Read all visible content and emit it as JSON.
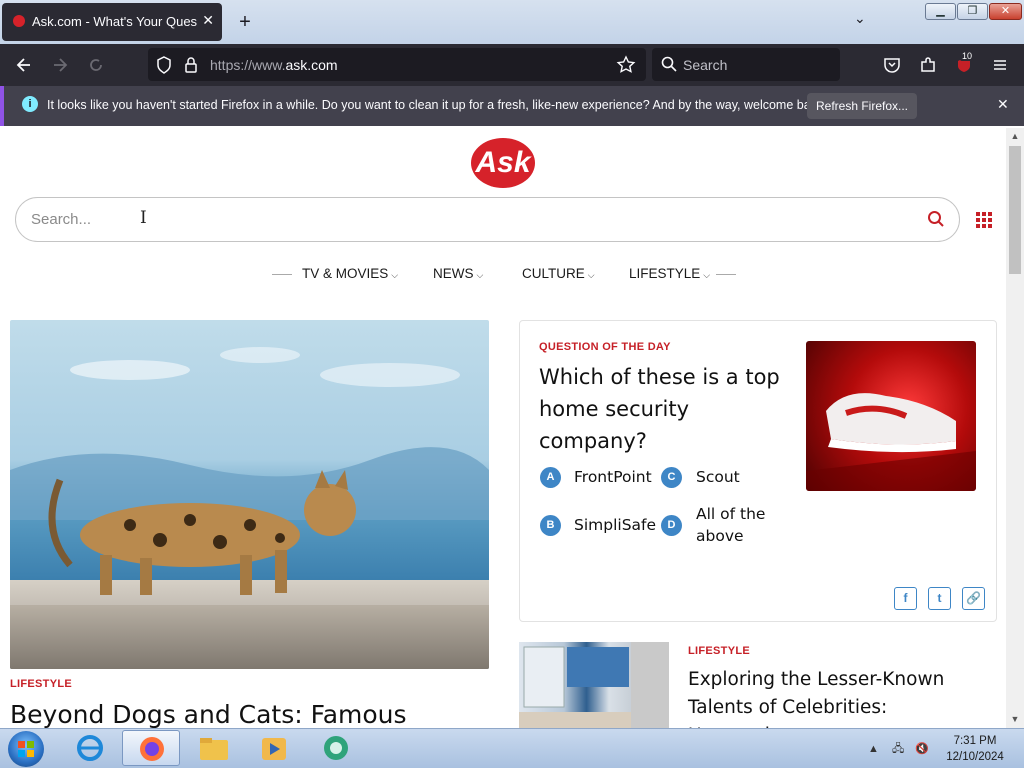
{
  "browser": {
    "tab_title": "Ask.com - What's Your Question",
    "tab_close": "✕",
    "new_tab": "+",
    "tab_list": "⌄",
    "url_prefix": "https://www.",
    "url_domain": "ask.com",
    "search_placeholder": "Search",
    "extension_badge": "10",
    "notification": {
      "message": "It looks like you haven't started Firefox in a while. Do you want to clean it up for a fresh, like-new experience? And by the way, welcome back!",
      "button": "Refresh Firefox...",
      "close": "✕"
    }
  },
  "page": {
    "logo": "Ask",
    "search_placeholder": "Search...",
    "nav": [
      "TV & MOVIES",
      "NEWS",
      "CULTURE",
      "LIFESTYLE"
    ],
    "hero": {
      "category": "LIFESTYLE",
      "title": "Beyond Dogs and Cats: Famous"
    },
    "qotd": {
      "category": "QUESTION OF THE DAY",
      "question": "Which of these is a top home security company?",
      "options": [
        {
          "letter": "A",
          "text": "FrontPoint"
        },
        {
          "letter": "C",
          "text": "Scout"
        },
        {
          "letter": "B",
          "text": "SimpliSafe"
        },
        {
          "letter": "D",
          "text": "All of the above"
        }
      ],
      "share": [
        "f",
        "t",
        "🔗"
      ]
    },
    "article2": {
      "category": "LIFESTYLE",
      "title": "Exploring the Lesser-Known Talents of Celebrities: Uncovering"
    }
  },
  "taskbar": {
    "time": "7:31 PM",
    "date": "12/10/2024"
  },
  "colors": {
    "accent_red": "#c62027",
    "option_blue": "#3e86c6",
    "firefox_dark": "#2b2a33"
  }
}
